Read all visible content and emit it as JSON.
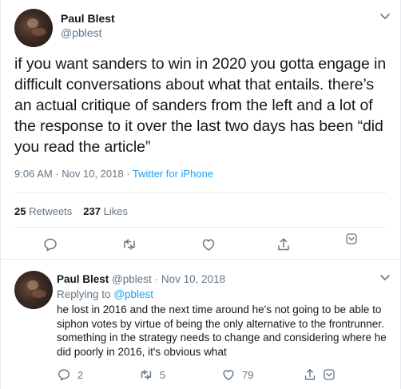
{
  "main_tweet": {
    "author_name": "Paul Blest",
    "author_handle": "@pblest",
    "text": "if you want sanders to win in 2020 you gotta engage in difficult conversations about what that entails. there’s an actual critique of sanders from the left and a lot of the response to it over the last two days has been “did you read the article”",
    "timestamp": "9:06 AM · Nov 10, 2018 · ",
    "source": "Twitter for iPhone",
    "retweets_count": "25",
    "retweets_label": "Retweets",
    "likes_count": "237",
    "likes_label": "Likes",
    "actions": [
      "reply-icon",
      "retweet-icon",
      "like-icon",
      "share-icon"
    ]
  },
  "reply": {
    "author_name": "Paul Blest",
    "author_handle": "@pblest",
    "separator": "·",
    "date": "Nov 10, 2018",
    "replying_to_prefix": "Replying to",
    "replying_to_mention": "@pblest",
    "text": "he lost in 2016 and the next time around he's not going to be able to siphon votes by virtue of being the only alternative to the frontrunner. something in the strategy needs to change and considering where he did poorly in 2016, it's obvious what",
    "reply_count": "2",
    "retweet_count": "5",
    "like_count": "79"
  },
  "colors": {
    "accent": "#1da1f2",
    "muted": "#657786",
    "text": "#14171a",
    "border": "#e6ecf0"
  }
}
